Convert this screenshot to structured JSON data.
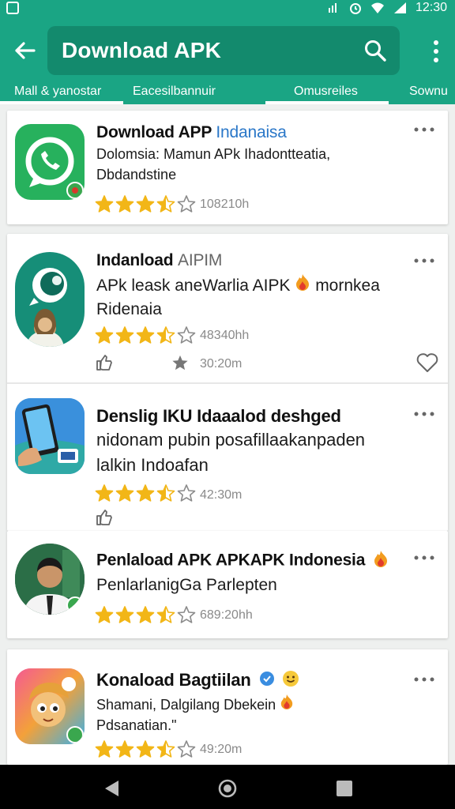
{
  "status_bar": {
    "time": "12:30",
    "icons": [
      "notification-icon",
      "wifi-icon",
      "alarm-icon",
      "signal-icon",
      "battery-icon"
    ]
  },
  "app_bar": {
    "search_query": "Download APK"
  },
  "tabs": [
    {
      "label": "Mall & yanostar"
    },
    {
      "label": "Eacesilbannuir"
    },
    {
      "label": "Omusreiles"
    },
    {
      "label": "Sownu"
    }
  ],
  "results": [
    {
      "title": "Download APP",
      "title_accent": "Indanaisa",
      "desc_lines": [
        "Dolomsia: Mamun APk Ihadontteatia,",
        "Dbdandstine"
      ],
      "rating": 3.5,
      "meta": "108210h",
      "icon": "whatsapp-icon"
    },
    {
      "title": "Indanload",
      "title_accent": "AIPIM",
      "desc_lines": [
        "APk leask aneWarlia AIPK",
        "Ridenaia"
      ],
      "desc_suffix": "mornkea",
      "rating": 3.5,
      "meta": "48340hh",
      "meta2": "30:20m",
      "icon": "chat-bubble-icon"
    },
    {
      "title": "Denslig IKU Idaaalod deshged",
      "desc_lines": [
        "nidonam pubin posafillaakanpaden",
        "lalkin Indoafan"
      ],
      "rating": 3.5,
      "meta": "42:30m",
      "icon": "phone-game-icon"
    },
    {
      "title": "Penlaload APK APKAPK Indonesia",
      "desc_lines": [
        "PenlarlanigGa Parlepten"
      ],
      "rating": 3.5,
      "meta": "689:20hh",
      "icon": "person-icon"
    },
    {
      "title": "Konaload Bagtiilan",
      "desc_lines": [
        "Shamani, Dalgilang Dbekein",
        "Pdsanatian.\""
      ],
      "rating": 3.5,
      "meta": "49:20m",
      "icon": "cartoon-icon"
    }
  ],
  "colors": {
    "brand": "#1aa584",
    "star": "#f2b617",
    "accent": "#2a77c8"
  }
}
